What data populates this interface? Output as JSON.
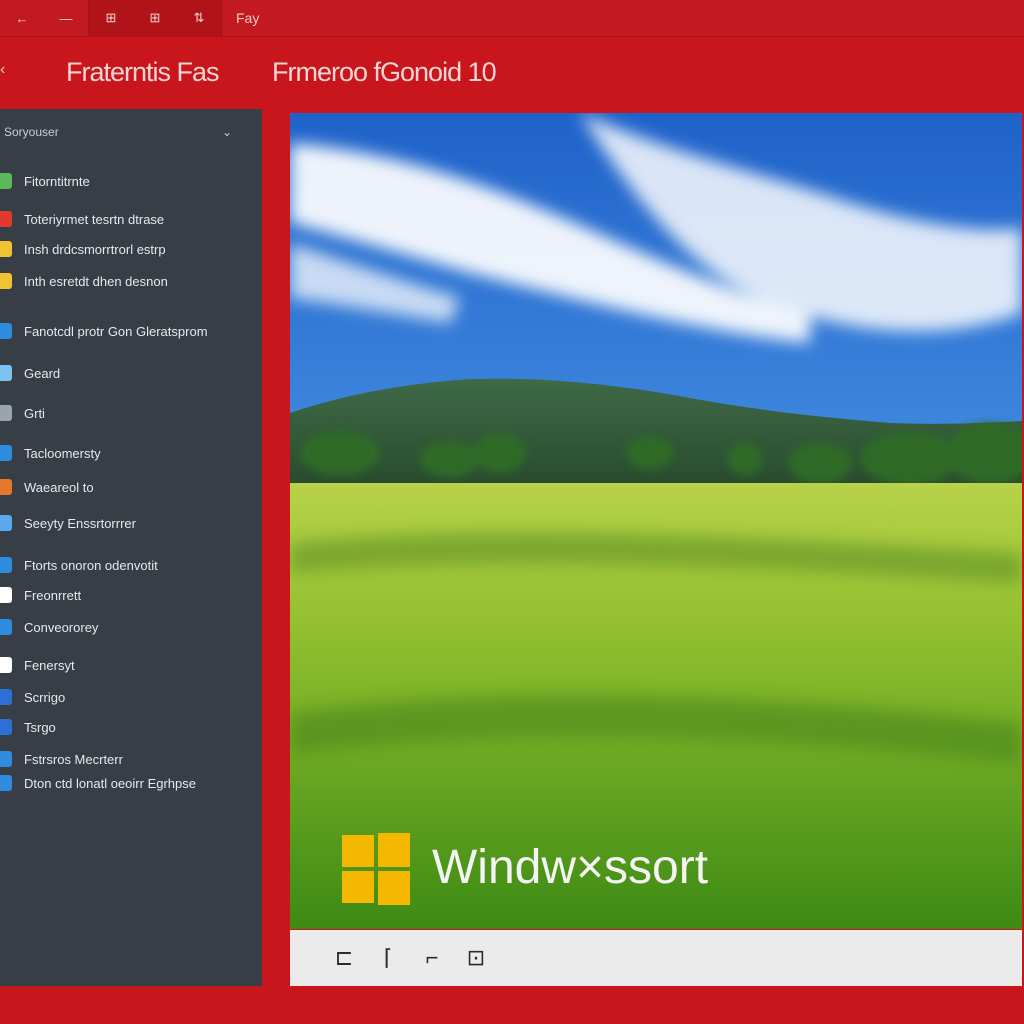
{
  "topbar": {
    "buttons": [
      "←",
      "—",
      "⊞",
      "⊞",
      "⇅"
    ],
    "text": "Fay"
  },
  "header": {
    "title_left": "Fraterntis Fas",
    "title_right": "Frmeroo fGonoid 10"
  },
  "sidebar": {
    "heading": "Soryouser",
    "items": [
      {
        "label": "Fitorntitrnte",
        "color": "#5cb85c"
      },
      {
        "label": "Toteriyrmet tesrtn dtrase",
        "color": "#e03a2f"
      },
      {
        "label": "Insh drdcsmorrtrorl estrp",
        "color": "#f1c232"
      },
      {
        "label": "Inth esretdt dhen desnon",
        "color": "#f1c232"
      },
      {
        "label": "Fanotcdl protr Gon Gleratsprom",
        "color": "#2e8bde"
      },
      {
        "label": "Geard",
        "color": "#7cc3f2"
      },
      {
        "label": "Grti",
        "color": "#9aa4ae"
      },
      {
        "label": "Tacloomersty",
        "color": "#2e8bde"
      },
      {
        "label": "Waeareol to",
        "color": "#e8772e"
      },
      {
        "label": "Seeyty Enssrtorrrer",
        "color": "#5aa9ec"
      },
      {
        "label": "Ftorts onoron odenvotit",
        "color": "#2e8bde"
      },
      {
        "label": "Freonrrett",
        "color": "#ffffff"
      },
      {
        "label": "Conveororey",
        "color": "#2e8bde"
      },
      {
        "label": "Fenersyt",
        "color": "#ffffff"
      },
      {
        "label": "Scrrigo",
        "color": "#2e6fd6"
      },
      {
        "label": "Tsrgo",
        "color": "#2e6fd6"
      },
      {
        "label": "Fstrsros Mecrterr",
        "color": "#2e8bde"
      },
      {
        "label": "Dton ctd lonatl oeoirr Egrhpse",
        "color": "#2e8bde"
      }
    ]
  },
  "wallpaper": {
    "brand_text": "Windw×ssort",
    "logo_color": "#f5b800"
  },
  "bottombar": {
    "buttons": [
      "⊏",
      "⌈",
      "⌐",
      "⊡"
    ]
  }
}
